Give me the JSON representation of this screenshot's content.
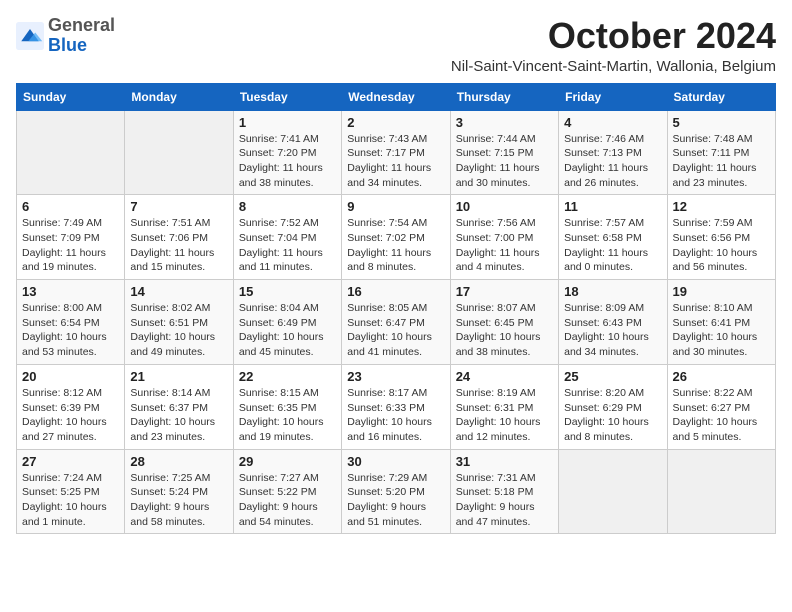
{
  "header": {
    "logo_general": "General",
    "logo_blue": "Blue",
    "month_title": "October 2024",
    "subtitle": "Nil-Saint-Vincent-Saint-Martin, Wallonia, Belgium"
  },
  "days_of_week": [
    "Sunday",
    "Monday",
    "Tuesday",
    "Wednesday",
    "Thursday",
    "Friday",
    "Saturday"
  ],
  "weeks": [
    [
      {
        "day": "",
        "info": ""
      },
      {
        "day": "",
        "info": ""
      },
      {
        "day": "1",
        "info": "Sunrise: 7:41 AM\nSunset: 7:20 PM\nDaylight: 11 hours and 38 minutes."
      },
      {
        "day": "2",
        "info": "Sunrise: 7:43 AM\nSunset: 7:17 PM\nDaylight: 11 hours and 34 minutes."
      },
      {
        "day": "3",
        "info": "Sunrise: 7:44 AM\nSunset: 7:15 PM\nDaylight: 11 hours and 30 minutes."
      },
      {
        "day": "4",
        "info": "Sunrise: 7:46 AM\nSunset: 7:13 PM\nDaylight: 11 hours and 26 minutes."
      },
      {
        "day": "5",
        "info": "Sunrise: 7:48 AM\nSunset: 7:11 PM\nDaylight: 11 hours and 23 minutes."
      }
    ],
    [
      {
        "day": "6",
        "info": "Sunrise: 7:49 AM\nSunset: 7:09 PM\nDaylight: 11 hours and 19 minutes."
      },
      {
        "day": "7",
        "info": "Sunrise: 7:51 AM\nSunset: 7:06 PM\nDaylight: 11 hours and 15 minutes."
      },
      {
        "day": "8",
        "info": "Sunrise: 7:52 AM\nSunset: 7:04 PM\nDaylight: 11 hours and 11 minutes."
      },
      {
        "day": "9",
        "info": "Sunrise: 7:54 AM\nSunset: 7:02 PM\nDaylight: 11 hours and 8 minutes."
      },
      {
        "day": "10",
        "info": "Sunrise: 7:56 AM\nSunset: 7:00 PM\nDaylight: 11 hours and 4 minutes."
      },
      {
        "day": "11",
        "info": "Sunrise: 7:57 AM\nSunset: 6:58 PM\nDaylight: 11 hours and 0 minutes."
      },
      {
        "day": "12",
        "info": "Sunrise: 7:59 AM\nSunset: 6:56 PM\nDaylight: 10 hours and 56 minutes."
      }
    ],
    [
      {
        "day": "13",
        "info": "Sunrise: 8:00 AM\nSunset: 6:54 PM\nDaylight: 10 hours and 53 minutes."
      },
      {
        "day": "14",
        "info": "Sunrise: 8:02 AM\nSunset: 6:51 PM\nDaylight: 10 hours and 49 minutes."
      },
      {
        "day": "15",
        "info": "Sunrise: 8:04 AM\nSunset: 6:49 PM\nDaylight: 10 hours and 45 minutes."
      },
      {
        "day": "16",
        "info": "Sunrise: 8:05 AM\nSunset: 6:47 PM\nDaylight: 10 hours and 41 minutes."
      },
      {
        "day": "17",
        "info": "Sunrise: 8:07 AM\nSunset: 6:45 PM\nDaylight: 10 hours and 38 minutes."
      },
      {
        "day": "18",
        "info": "Sunrise: 8:09 AM\nSunset: 6:43 PM\nDaylight: 10 hours and 34 minutes."
      },
      {
        "day": "19",
        "info": "Sunrise: 8:10 AM\nSunset: 6:41 PM\nDaylight: 10 hours and 30 minutes."
      }
    ],
    [
      {
        "day": "20",
        "info": "Sunrise: 8:12 AM\nSunset: 6:39 PM\nDaylight: 10 hours and 27 minutes."
      },
      {
        "day": "21",
        "info": "Sunrise: 8:14 AM\nSunset: 6:37 PM\nDaylight: 10 hours and 23 minutes."
      },
      {
        "day": "22",
        "info": "Sunrise: 8:15 AM\nSunset: 6:35 PM\nDaylight: 10 hours and 19 minutes."
      },
      {
        "day": "23",
        "info": "Sunrise: 8:17 AM\nSunset: 6:33 PM\nDaylight: 10 hours and 16 minutes."
      },
      {
        "day": "24",
        "info": "Sunrise: 8:19 AM\nSunset: 6:31 PM\nDaylight: 10 hours and 12 minutes."
      },
      {
        "day": "25",
        "info": "Sunrise: 8:20 AM\nSunset: 6:29 PM\nDaylight: 10 hours and 8 minutes."
      },
      {
        "day": "26",
        "info": "Sunrise: 8:22 AM\nSunset: 6:27 PM\nDaylight: 10 hours and 5 minutes."
      }
    ],
    [
      {
        "day": "27",
        "info": "Sunrise: 7:24 AM\nSunset: 5:25 PM\nDaylight: 10 hours and 1 minute."
      },
      {
        "day": "28",
        "info": "Sunrise: 7:25 AM\nSunset: 5:24 PM\nDaylight: 9 hours and 58 minutes."
      },
      {
        "day": "29",
        "info": "Sunrise: 7:27 AM\nSunset: 5:22 PM\nDaylight: 9 hours and 54 minutes."
      },
      {
        "day": "30",
        "info": "Sunrise: 7:29 AM\nSunset: 5:20 PM\nDaylight: 9 hours and 51 minutes."
      },
      {
        "day": "31",
        "info": "Sunrise: 7:31 AM\nSunset: 5:18 PM\nDaylight: 9 hours and 47 minutes."
      },
      {
        "day": "",
        "info": ""
      },
      {
        "day": "",
        "info": ""
      }
    ]
  ]
}
